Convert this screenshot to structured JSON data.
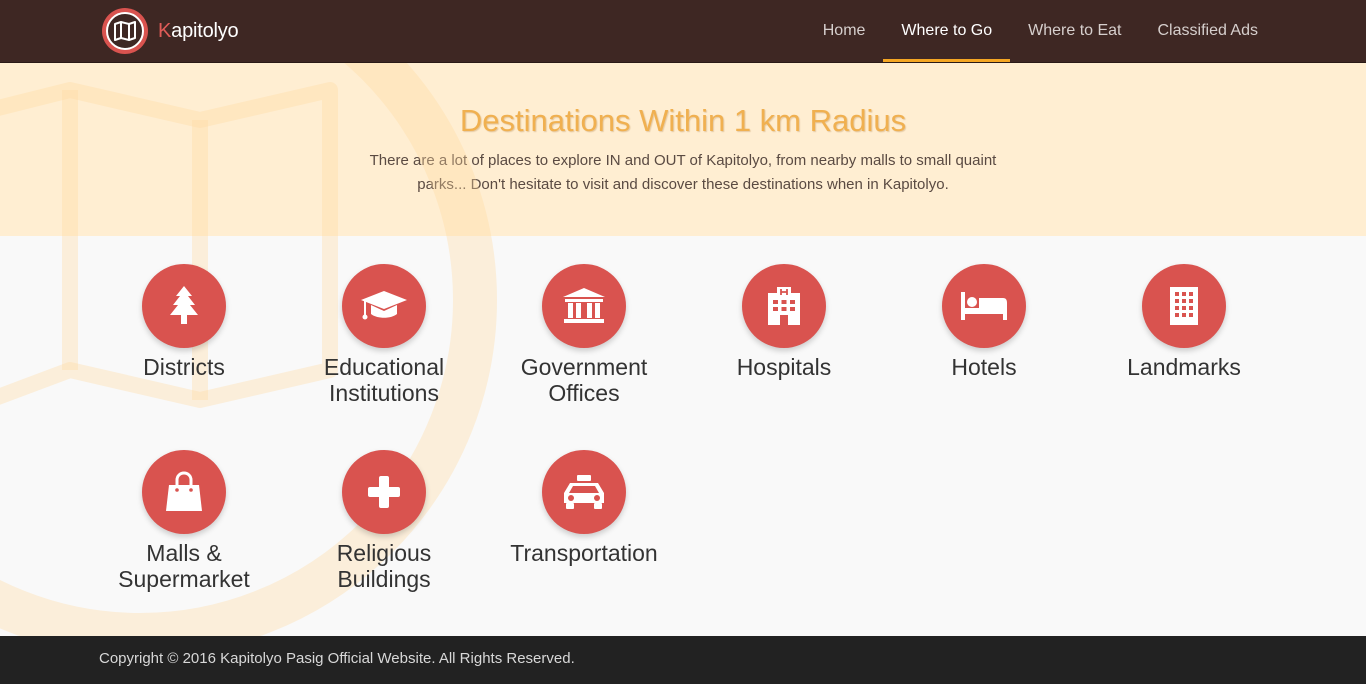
{
  "brand": {
    "name_first_letter": "K",
    "name_rest": "apitolyo",
    "logo_icon": "folded-map-icon"
  },
  "nav": {
    "items": [
      {
        "label": "Home",
        "active": false
      },
      {
        "label": "Where to Go",
        "active": true
      },
      {
        "label": "Where to Eat",
        "active": false
      },
      {
        "label": "Classified Ads",
        "active": false
      }
    ]
  },
  "hero": {
    "title": "Destinations Within 1 km Radius",
    "description": "There are a lot of places to explore IN and OUT of Kapitolyo, from nearby malls to small quaint parks... Don't hesitate to visit and discover these destinations when in Kapitolyo."
  },
  "categories": [
    {
      "label": "Districts",
      "icon": "tree-icon"
    },
    {
      "label": "Educational Institutions",
      "icon": "graduation-cap-icon"
    },
    {
      "label": "Government Offices",
      "icon": "government-building-icon"
    },
    {
      "label": "Hospitals",
      "icon": "hospital-icon"
    },
    {
      "label": "Hotels",
      "icon": "bed-icon"
    },
    {
      "label": "Landmarks",
      "icon": "building-icon"
    },
    {
      "label": "Malls & Supermarket",
      "icon": "shopping-bag-icon"
    },
    {
      "label": "Religious Buildings",
      "icon": "plus-icon"
    },
    {
      "label": "Transportation",
      "icon": "taxi-icon"
    }
  ],
  "footer": {
    "copyright": "Copyright © 2016 Kapitolyo Pasig Official Website. All Rights Reserved."
  },
  "colors": {
    "navbar": "#3e2723",
    "accent": "#f5a623",
    "icon_circle": "#d9534f",
    "hero_bg": "#ffeed2",
    "hero_title": "#f0b050",
    "footer": "#222222"
  }
}
